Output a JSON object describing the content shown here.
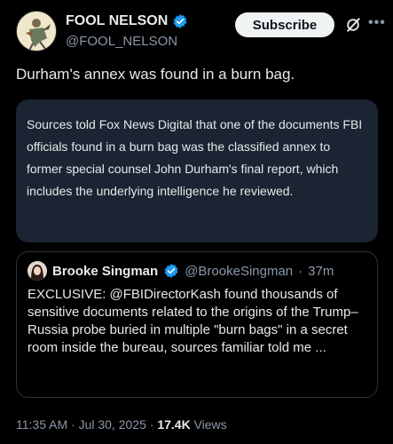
{
  "author": {
    "display_name": "FOOL NELSON",
    "handle": "@FOOL_NELSON",
    "verified": true
  },
  "actions": {
    "subscribe_label": "Subscribe",
    "grok_icon": "grok-icon",
    "more_icon": "more-icon"
  },
  "post": {
    "text": "Durham's annex was found in a burn bag."
  },
  "card": {
    "text": "Sources told Fox News Digital that one of the documents FBI officials found in a burn bag was the classified annex to former special counsel John Durham's final report, which includes the underlying intelligence he reviewed."
  },
  "quote": {
    "name": "Brooke Singman",
    "handle": "@BrookeSingman",
    "time": "37m",
    "text": "EXCLUSIVE: @FBIDirectorKash found thousands of sensitive documents related to the origins of the Trump–Russia probe buried in multiple \"burn bags\" in a secret room inside the bureau, sources familiar told me ..."
  },
  "footer": {
    "time": "11:35 AM",
    "date": "Jul 30, 2025",
    "views_count": "17.4K",
    "views_label": "Views"
  },
  "colors": {
    "background": "#000000",
    "verified": "#1d9bf0",
    "card_background": "#1a2432",
    "muted_text": "#8b98a5"
  }
}
